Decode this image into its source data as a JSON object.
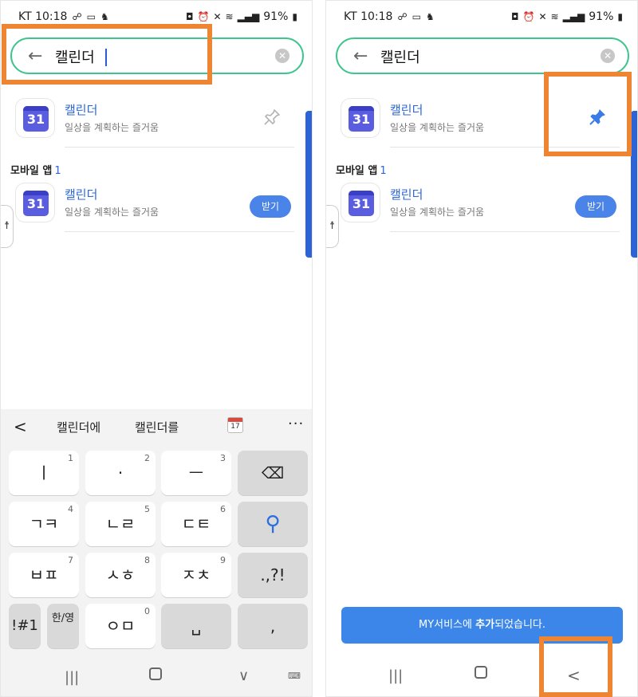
{
  "status": {
    "carrier_time": "KT 10:18",
    "battery": "91%"
  },
  "search": {
    "query": "캘린더"
  },
  "results": {
    "app_name": "캘린더",
    "app_desc": "일상을 계획하는 즐거움",
    "icon_day": "31"
  },
  "mobile_section": {
    "title": "모바일 앱",
    "count": "1",
    "app_name": "캘린더",
    "app_desc": "일상을 계획하는 즐거움",
    "icon_day": "31",
    "get_label": "받기"
  },
  "keyboard": {
    "suggestions": [
      "캘린더에",
      "캘린더를"
    ],
    "calendar_day": "17",
    "keys": [
      {
        "label": "ㅣ",
        "num": "1"
      },
      {
        "label": "·",
        "num": "2"
      },
      {
        "label": "ㅡ",
        "num": "3"
      },
      {
        "label": "ㄱㅋ",
        "num": "4"
      },
      {
        "label": "ㄴㄹ",
        "num": "5"
      },
      {
        "label": "ㄷㅌ",
        "num": "6"
      },
      {
        "label": "ㅂㅍ",
        "num": "7"
      },
      {
        "label": "ㅅㅎ",
        "num": "8"
      },
      {
        "label": "ㅈㅊ",
        "num": "9"
      },
      {
        "label": ".,?!",
        "num": ""
      },
      {
        "label": "!#1",
        "num": ""
      },
      {
        "label": "한/영",
        "num": ""
      },
      {
        "label": "ㅇㅁ",
        "num": "0"
      },
      {
        "label": ",",
        "num": ""
      }
    ]
  },
  "toast": {
    "prefix": "MY서비스에 ",
    "bold": "추가",
    "suffix": "되었습니다."
  },
  "colors": {
    "accent_green": "#3fc58d",
    "brand_blue": "#2b66d9",
    "highlight": "#ee8533"
  }
}
